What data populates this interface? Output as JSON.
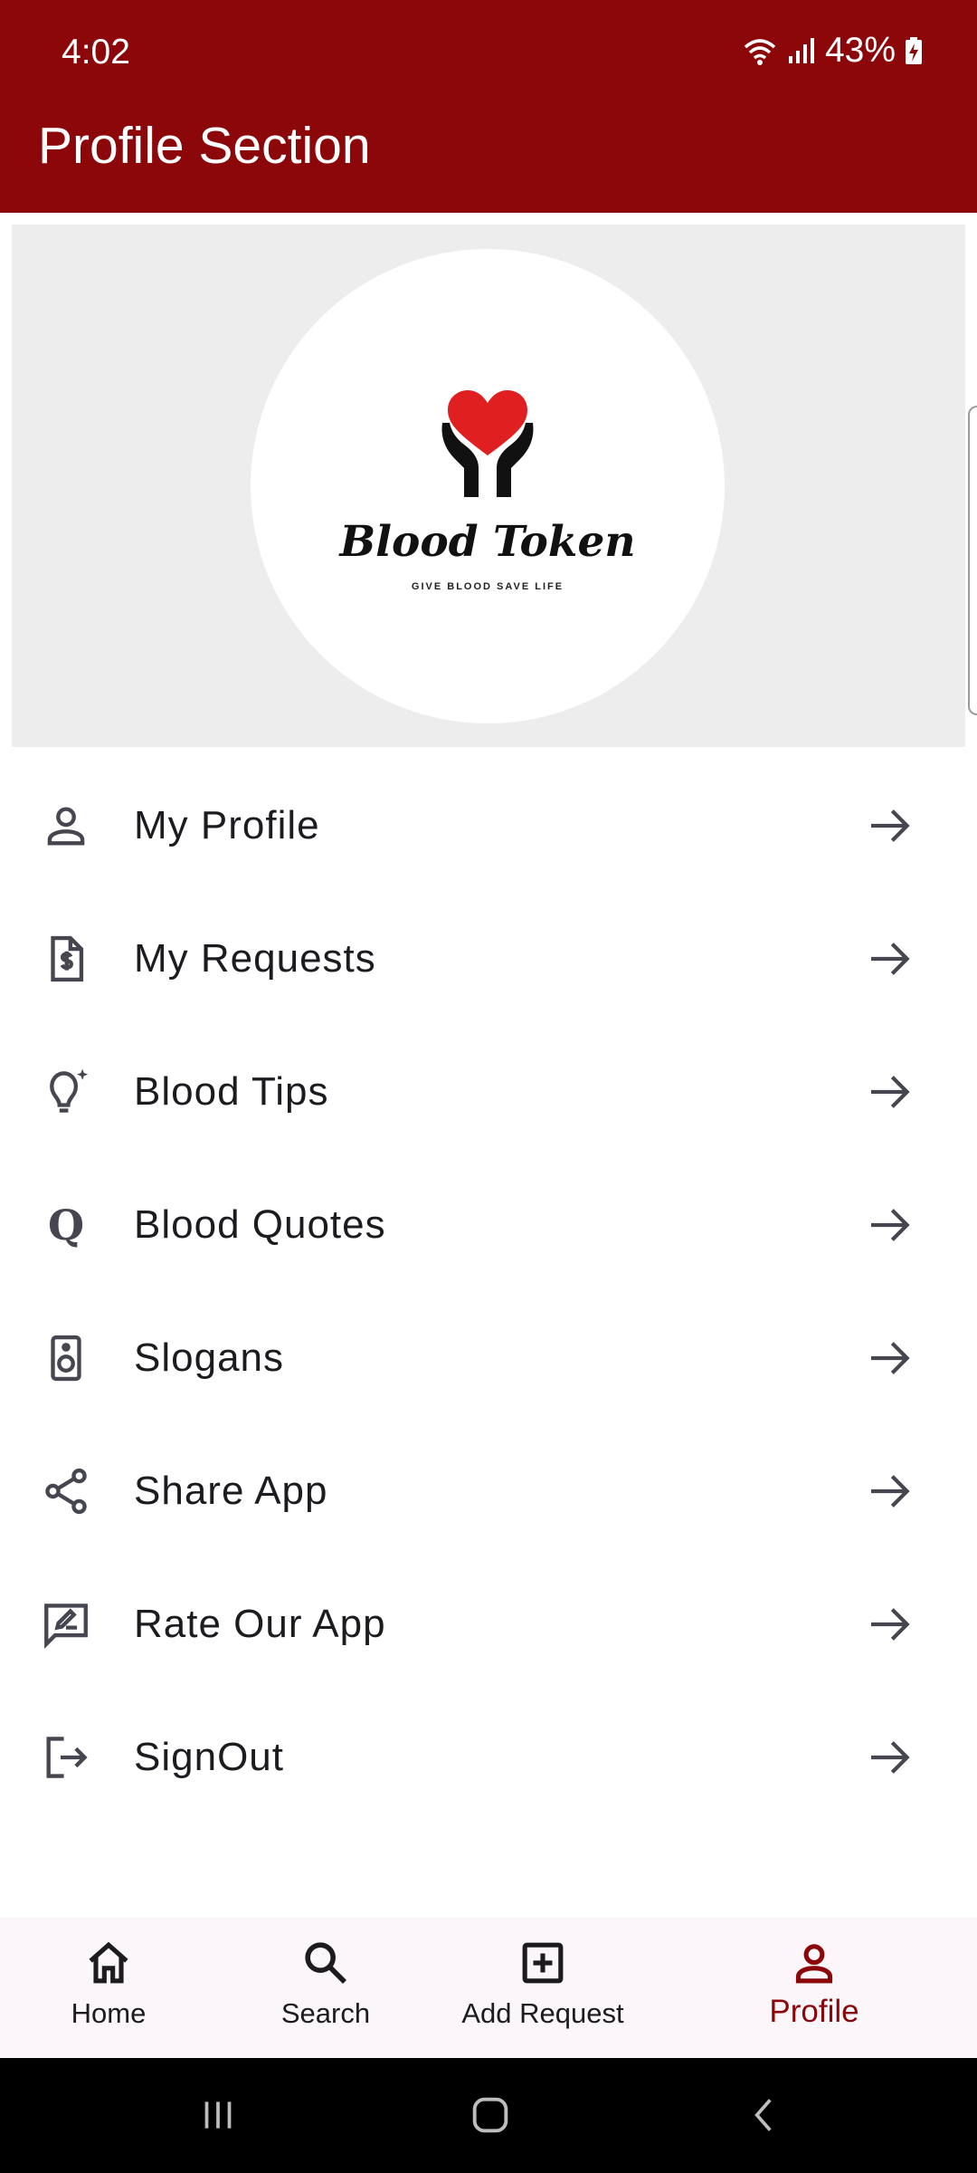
{
  "status_bar": {
    "time": "4:02",
    "battery": "43%"
  },
  "app_bar": {
    "title": "Profile Section"
  },
  "logo": {
    "name": "Blood Token",
    "tagline": "GIVE BLOOD SAVE LIFE"
  },
  "menu": [
    {
      "label": "My Profile",
      "icon": "person-icon"
    },
    {
      "label": "My Requests",
      "icon": "receipt-dollar-icon"
    },
    {
      "label": "Blood Tips",
      "icon": "lightbulb-icon"
    },
    {
      "label": "Blood Quotes",
      "icon": "quote-q-icon"
    },
    {
      "label": "Slogans",
      "icon": "speaker-icon"
    },
    {
      "label": "Share App",
      "icon": "share-icon"
    },
    {
      "label": "Rate Our App",
      "icon": "rate-review-icon"
    },
    {
      "label": "SignOut",
      "icon": "logout-icon"
    }
  ],
  "bottom_nav": [
    {
      "label": "Home",
      "icon": "home-icon"
    },
    {
      "label": "Search",
      "icon": "search-icon"
    },
    {
      "label": "Add Request",
      "icon": "add-box-icon"
    },
    {
      "label": "Profile",
      "icon": "person-icon",
      "active": true
    }
  ],
  "colors": {
    "primary": "#8b0709",
    "heart": "#e02020",
    "card_bg": "#ededed",
    "nav_bg": "#fbf6f9"
  }
}
